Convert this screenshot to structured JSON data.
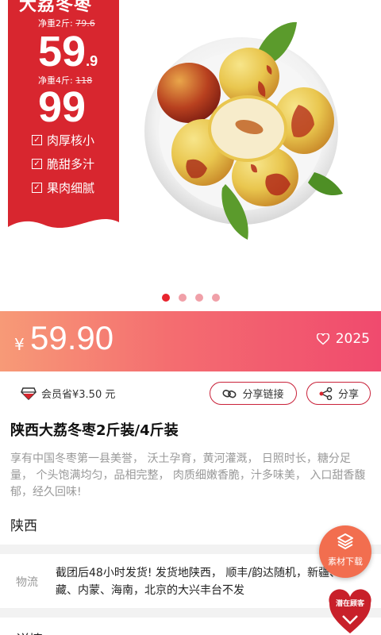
{
  "banner": {
    "title": "大荔冬枣",
    "price_2jin_label": "净重2斤:",
    "price_2jin_old": "79.6",
    "price_2jin_main": "59",
    "price_2jin_decimal": ".9",
    "price_4jin_label": "净重4斤:",
    "price_4jin_old": "118",
    "price_4jin_main": "99",
    "features": [
      "肉厚核小",
      "脆甜多汁",
      "果肉细腻"
    ],
    "carousel_count": 4,
    "carousel_active": 0
  },
  "price_bar": {
    "currency": "¥",
    "price": "59.90",
    "likes": "2025"
  },
  "info": {
    "member_saving": "会员省¥3.50 元",
    "share_link_label": "分享链接",
    "share_label": "分享",
    "title": "陕西大荔冬枣2斤装/4斤装",
    "description": "享有中国冬枣第一县美誉， 沃土孕育，黄河灌溉， 日照时长，糖分足量， 个头饱满均匀，品相完整， 肉质细嫩香脆，汁多味美， 入口甜香馥郁，经久回味!",
    "origin": "陕西"
  },
  "logistics": {
    "label": "物流",
    "text": "截团后48小时发货! 发货地陕西， 顺丰/韵达随机，新疆、西藏、内蒙、海南，北京的大兴丰台不发"
  },
  "detail": {
    "label": "详情"
  },
  "floating": {
    "download_label": "素材下载",
    "badge_label": "潜在顾客"
  },
  "colors": {
    "brand_red": "#e8242e",
    "flag_red": "#d8262f",
    "gradient_start": "#f79a77",
    "gradient_end": "#f04a6e",
    "fab_orange": "#f26e4f"
  }
}
